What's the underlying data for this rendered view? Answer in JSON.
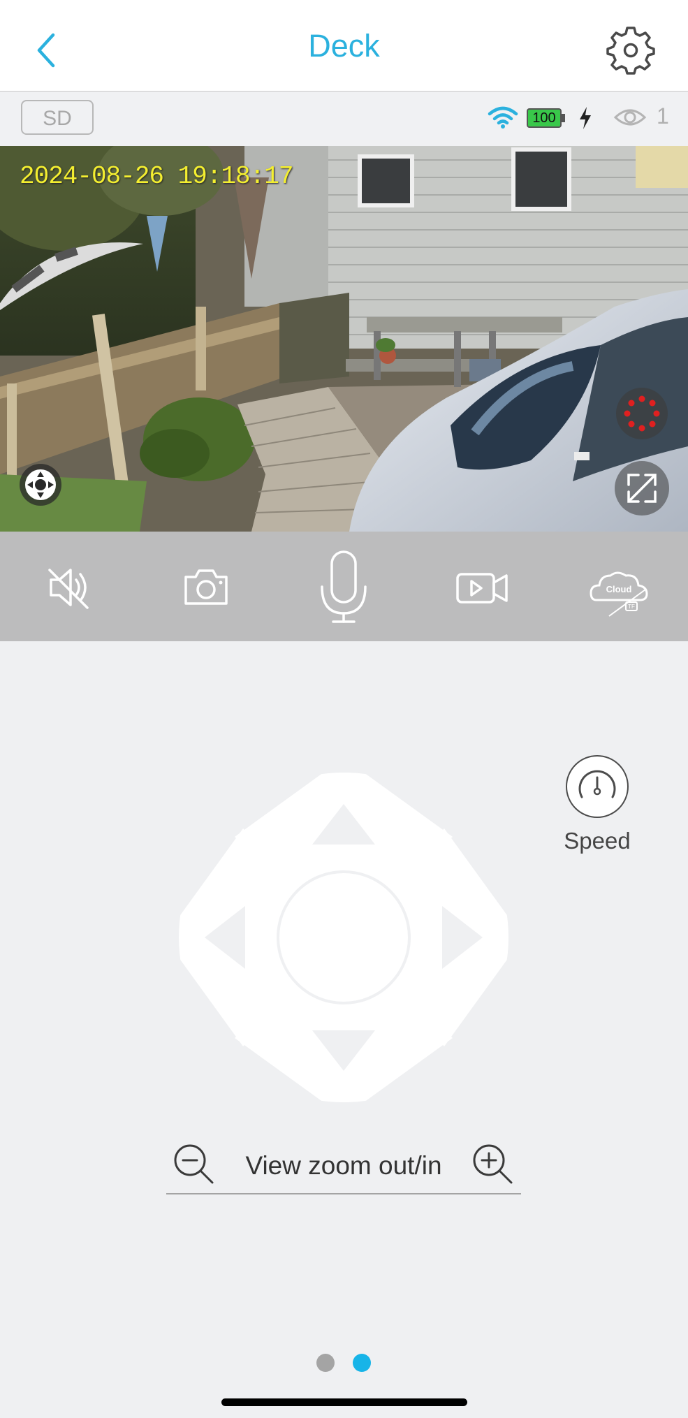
{
  "header": {
    "title": "Deck"
  },
  "status": {
    "sd_label": "SD",
    "battery_level": "100",
    "viewers": "1"
  },
  "video": {
    "timestamp": "2024-08-26  19:18:17"
  },
  "controls": {
    "mute_icon": "speaker-muted-icon",
    "snapshot_icon": "camera-icon",
    "talk_icon": "microphone-icon",
    "record_icon": "video-record-icon",
    "cloud_label": "Cloud",
    "cloud_sub_label": "TF"
  },
  "ptz": {
    "speed_label": "Speed",
    "zoom_label": "View zoom out/in"
  },
  "pager": {
    "pages": 2,
    "active_page": 2
  },
  "colors": {
    "accent": "#2bb1de",
    "battery": "#39c84a",
    "timestamp": "#f4ef30",
    "record_dot": "#e02020"
  }
}
